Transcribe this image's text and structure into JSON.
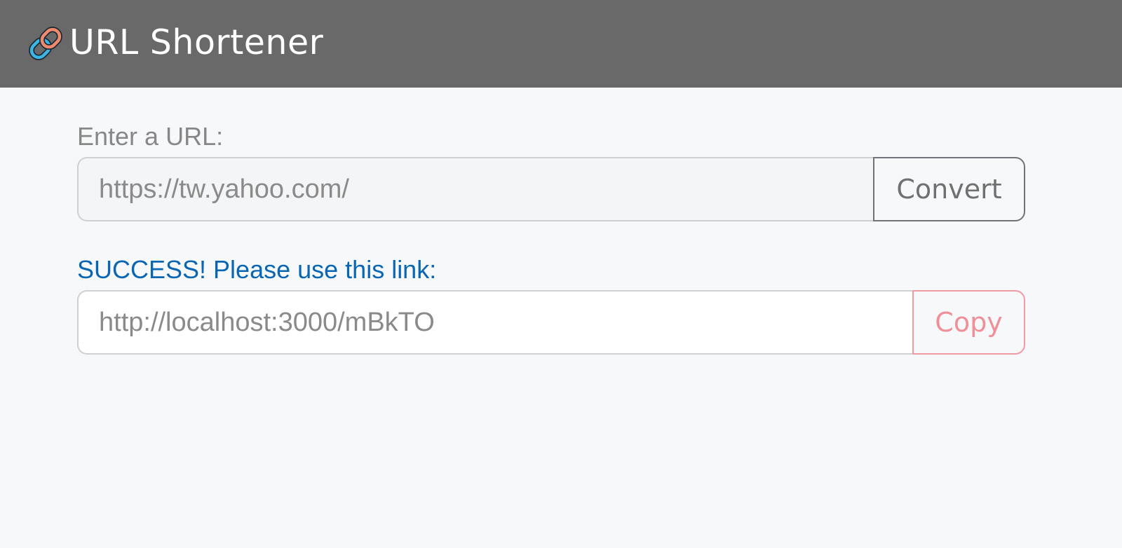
{
  "header": {
    "logo_icon": "link-icon",
    "title": "URL Shortener"
  },
  "form": {
    "url_label": "Enter a URL:",
    "url_value": "https://tw.yahoo.com/",
    "convert_label": "Convert"
  },
  "result": {
    "status_text": "SUCCESS! Please use this link:",
    "short_url": "http://localhost:3000/mBkTO",
    "copy_label": "Copy"
  },
  "colors": {
    "header_bg": "#696969",
    "page_bg": "#f7f8fa",
    "success_text": "#0a66b2",
    "convert_border": "#707378",
    "copy_accent": "#ef8f97",
    "link_icon_blue": "#3bb7e6",
    "link_icon_orange": "#ee8a6e"
  }
}
